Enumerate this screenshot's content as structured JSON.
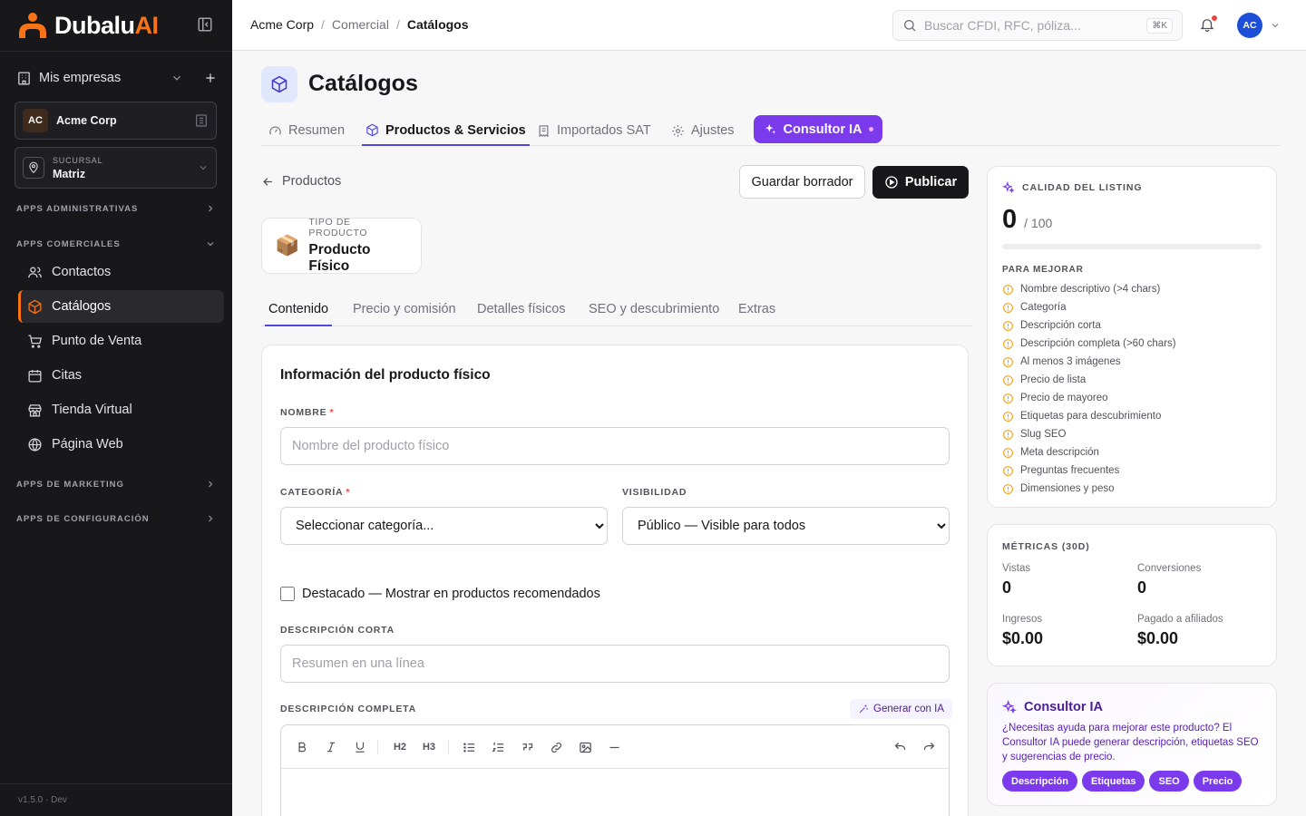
{
  "sidebar": {
    "brand": {
      "name_main": "Dubalu",
      "name_accent": "AI"
    },
    "companies_label": "Mis empresas",
    "company": {
      "initials": "AC",
      "name": "Acme Corp"
    },
    "branch": {
      "label": "SUCURSAL",
      "name": "Matriz"
    },
    "sections": {
      "admin": "APPS ADMINISTRATIVAS",
      "commercial": "APPS COMERCIALES",
      "marketing": "APPS DE MARKETING",
      "config": "APPS DE CONFIGURACIÓN"
    },
    "items": [
      {
        "label": "Contactos",
        "icon": "users-icon"
      },
      {
        "label": "Catálogos",
        "icon": "package-icon",
        "active": true
      },
      {
        "label": "Punto de Venta",
        "icon": "cart-icon"
      },
      {
        "label": "Citas",
        "icon": "calendar-icon"
      },
      {
        "label": "Tienda Virtual",
        "icon": "store-icon"
      },
      {
        "label": "Página Web",
        "icon": "globe-icon"
      }
    ],
    "version": "v1.5.0 · Dev"
  },
  "topbar": {
    "breadcrumb": [
      "Acme Corp",
      "Comercial",
      "Catálogos"
    ],
    "search_placeholder": "Buscar CFDI, RFC, póliza...",
    "search_shortcut": "⌘K",
    "avatar_initials": "AC"
  },
  "page": {
    "title": "Catálogos",
    "tabs": [
      "Resumen",
      "Productos & Servicios",
      "Importados SAT",
      "Ajustes"
    ],
    "active_tab": "Productos & Servicios",
    "ai_tab": "Consultor IA"
  },
  "editor": {
    "back_label": "Productos",
    "save_draft": "Guardar borrador",
    "publish": "Publicar",
    "product_type_label": "TIPO DE PRODUCTO",
    "product_type_value": "Producto Físico",
    "subtabs": [
      "Contenido",
      "Precio y comisión",
      "Detalles físicos",
      "SEO y descubrimiento",
      "Extras"
    ],
    "active_subtab": "Contenido"
  },
  "form": {
    "card_title": "Información del producto físico",
    "name_label": "NOMBRE",
    "name_placeholder": "Nombre del producto físico",
    "name_value": "",
    "category_label": "CATEGORÍA",
    "category_selected": "Seleccionar categoría...",
    "visibility_label": "VISIBILIDAD",
    "visibility_selected": "Público — Visible para todos",
    "featured_label": "Destacado — Mostrar en productos recomendados",
    "featured_checked": false,
    "short_desc_label": "DESCRIPCIÓN CORTA",
    "short_desc_placeholder": "Resumen en una línea",
    "full_desc_label": "DESCRIPCIÓN COMPLETA",
    "generate_ai": "Generar con IA",
    "toolbar": {
      "h2": "H2",
      "h3": "H3"
    }
  },
  "quality": {
    "title": "CALIDAD DEL LISTING",
    "score": "0",
    "max": "/ 100",
    "progress_percent": 0,
    "improve_title": "PARA MEJORAR",
    "items": [
      "Nombre descriptivo (>4 chars)",
      "Categoría",
      "Descripción corta",
      "Descripción completa (>60 chars)",
      "Al menos 3 imágenes",
      "Precio de lista",
      "Precio de mayoreo",
      "Etiquetas para descubrimiento",
      "Slug SEO",
      "Meta descripción",
      "Preguntas frecuentes",
      "Dimensiones y peso"
    ]
  },
  "metrics": {
    "title": "MÉTRICAS (30D)",
    "views_label": "Vistas",
    "views": "0",
    "conversions_label": "Conversiones",
    "conversions": "0",
    "revenue_label": "Ingresos",
    "revenue": "$0.00",
    "affiliates_label": "Pagado a afiliados",
    "affiliates": "$0.00"
  },
  "ai_consultant": {
    "title": "Consultor IA",
    "text": "¿Necesitas ayuda para mejorar este producto? El Consultor IA puede generar descripción, etiquetas SEO y sugerencias de precio.",
    "chips": [
      "Descripción",
      "Etiquetas",
      "SEO",
      "Precio"
    ]
  },
  "colors": {
    "brand": "#f97316",
    "accent": "#4f46e5",
    "ai": "#7c3aed",
    "sidebar_bg": "#18181b",
    "warning": "#f59e0b"
  }
}
